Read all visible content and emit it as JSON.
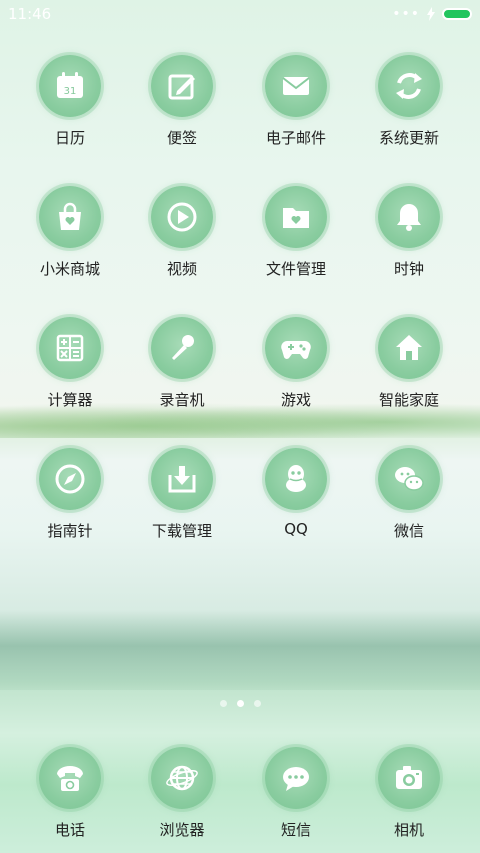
{
  "status": {
    "time": "11:46",
    "battery_color": "#22c55e"
  },
  "apps": [
    {
      "label": "日历",
      "icon": "calendar-icon",
      "badge": "31"
    },
    {
      "label": "便签",
      "icon": "notes-icon"
    },
    {
      "label": "电子邮件",
      "icon": "mail-icon"
    },
    {
      "label": "系统更新",
      "icon": "refresh-icon"
    },
    {
      "label": "小米商城",
      "icon": "shop-bag-icon"
    },
    {
      "label": "视频",
      "icon": "play-icon"
    },
    {
      "label": "文件管理",
      "icon": "folder-icon"
    },
    {
      "label": "时钟",
      "icon": "bell-icon"
    },
    {
      "label": "计算器",
      "icon": "calculator-icon"
    },
    {
      "label": "录音机",
      "icon": "microphone-icon"
    },
    {
      "label": "游戏",
      "icon": "gamepad-icon"
    },
    {
      "label": "智能家庭",
      "icon": "home-icon"
    },
    {
      "label": "指南针",
      "icon": "compass-icon"
    },
    {
      "label": "下载管理",
      "icon": "download-icon"
    },
    {
      "label": "QQ",
      "icon": "qq-penguin-icon"
    },
    {
      "label": "微信",
      "icon": "wechat-icon"
    }
  ],
  "page_indicator": {
    "pages": 3,
    "current": 2
  },
  "dock": [
    {
      "label": "电话",
      "icon": "phone-icon"
    },
    {
      "label": "浏览器",
      "icon": "browser-globe-icon"
    },
    {
      "label": "短信",
      "icon": "message-icon"
    },
    {
      "label": "相机",
      "icon": "camera-icon"
    }
  ]
}
